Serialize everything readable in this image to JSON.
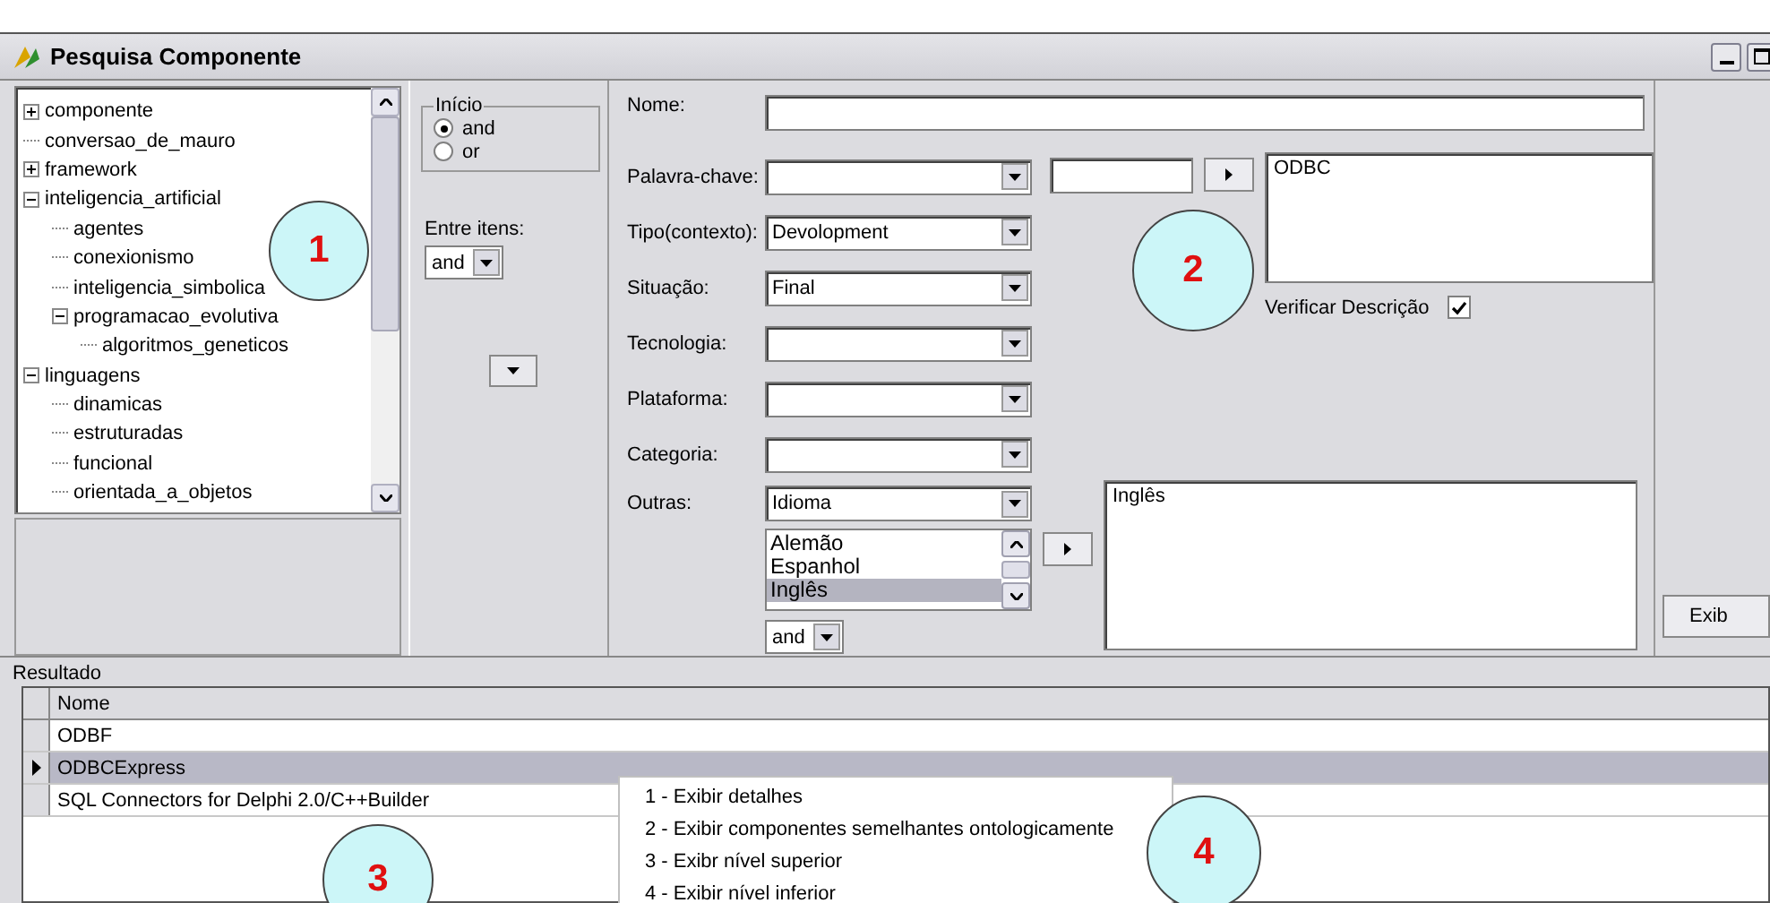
{
  "window": {
    "title": "Pesquisa Componente"
  },
  "tree": [
    {
      "label": "componente",
      "expanded": false
    },
    {
      "label": "conversao_de_mauro"
    },
    {
      "label": "framework",
      "expanded": false
    },
    {
      "label": "inteligencia_artificial",
      "expanded": true,
      "children": [
        {
          "label": "agentes"
        },
        {
          "label": "conexionismo"
        },
        {
          "label": "inteligencia_simbolica"
        },
        {
          "label": "programacao_evolutiva",
          "expanded": true,
          "children": [
            {
              "label": "algoritmos_geneticos"
            }
          ]
        }
      ]
    },
    {
      "label": "linguagens",
      "expanded": true,
      "children": [
        {
          "label": "dinamicas"
        },
        {
          "label": "estruturadas"
        },
        {
          "label": "funcional"
        },
        {
          "label": "orientada_a_objetos"
        }
      ]
    }
  ],
  "options": {
    "group_title": "Início",
    "radios": [
      {
        "label": "and",
        "selected": true
      },
      {
        "label": "or",
        "selected": false
      }
    ],
    "between_label": "Entre itens:",
    "between_value": "and"
  },
  "fields": [
    {
      "label": "Nome:",
      "kind": "text"
    },
    {
      "label": "Palavra-chave:",
      "kind": "combo"
    },
    {
      "label": "Tipo(contexto):",
      "kind": "combo",
      "value": "Devolopment"
    },
    {
      "label": "Situação:",
      "kind": "combo",
      "value": "Final"
    },
    {
      "label": "Tecnologia:",
      "kind": "combo"
    },
    {
      "label": "Plataforma:",
      "kind": "combo"
    },
    {
      "label": "Categoria:",
      "kind": "combo"
    }
  ],
  "keywords": [
    "ODBC"
  ],
  "verify": {
    "label": "Verificar Descrição",
    "checked": true
  },
  "others": {
    "label": "Outras:",
    "category": "Idioma",
    "options": [
      {
        "label": "Alemão",
        "selected": false
      },
      {
        "label": "Espanhol",
        "selected": false
      },
      {
        "label": "Inglês",
        "selected": true
      }
    ],
    "operator": "and",
    "chosen": [
      "Inglês"
    ]
  },
  "side_button": "Exib",
  "result": {
    "title": "Resultado",
    "column": "Nome",
    "rows": [
      {
        "name": "ODBF",
        "selected": false
      },
      {
        "name": "ODBCExpress",
        "selected": true
      },
      {
        "name": "SQL Connectors for Delphi 2.0/C++Builder",
        "selected": false
      }
    ]
  },
  "context_menu": [
    "1 - Exibir detalhes",
    "2 - Exibir componentes semelhantes ontologicamente",
    "3 - Exibr nível superior",
    "4 - Exibir nível inferior"
  ],
  "callouts": [
    "1",
    "2",
    "3",
    "4"
  ]
}
